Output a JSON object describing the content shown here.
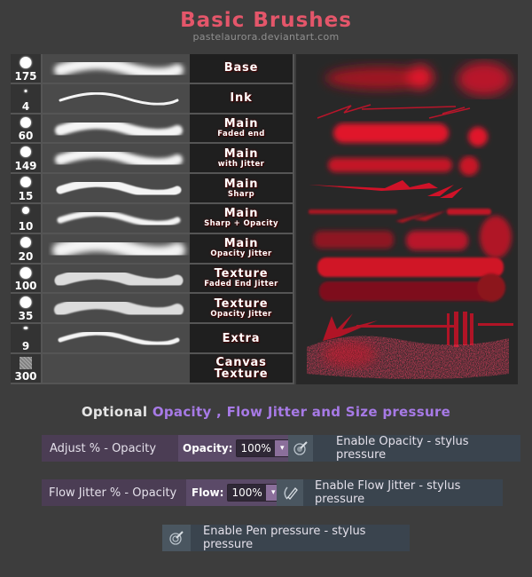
{
  "header": {
    "title": "Basic Brushes",
    "subtitle": "pastelaurora.deviantart.com"
  },
  "brushes": [
    {
      "size": "175",
      "name": "Base",
      "sub": ""
    },
    {
      "size": "4",
      "name": "Ink",
      "sub": ""
    },
    {
      "size": "60",
      "name": "Main",
      "sub": "Faded end"
    },
    {
      "size": "149",
      "name": "Main",
      "sub": "with Jitter"
    },
    {
      "size": "15",
      "name": "Main",
      "sub": "Sharp"
    },
    {
      "size": "10",
      "name": "Main",
      "sub": "Sharp + Opacity"
    },
    {
      "size": "20",
      "name": "Main",
      "sub": "Opacity Jitter"
    },
    {
      "size": "100",
      "name": "Texture",
      "sub": "Faded End Jitter"
    },
    {
      "size": "35",
      "name": "Texture",
      "sub": "Opacity Jitter"
    },
    {
      "size": "9",
      "name": "Extra",
      "sub": ""
    },
    {
      "size": "300",
      "name": "Canvas Texture",
      "sub": ""
    }
  ],
  "colors": {
    "title": "#e4566a",
    "accent_purple": "#a77ae6",
    "stroke_red": "#e0132b"
  },
  "optional": {
    "prefix": "Optional",
    "highlight": "Opacity , Flow Jitter and Size pressure"
  },
  "options": {
    "opacity": {
      "label": "Adjust % - Opacity",
      "control_label": "Opacity:",
      "value": "100%",
      "dropdown_icon": "chevron-down-icon",
      "toggle_icon": "airbrush-pressure-icon",
      "enable_label": "Enable Opacity - stylus pressure"
    },
    "flow": {
      "label": "Flow Jitter % - Opacity",
      "control_label": "Flow:",
      "value": "100%",
      "dropdown_icon": "chevron-down-icon",
      "toggle_icon": "pen-pressure-icon",
      "enable_label": "Enable Flow Jitter - stylus pressure"
    },
    "pen": {
      "toggle_icon": "pen-pressure-icon",
      "enable_label": "Enable Pen pressure - stylus pressure"
    }
  }
}
